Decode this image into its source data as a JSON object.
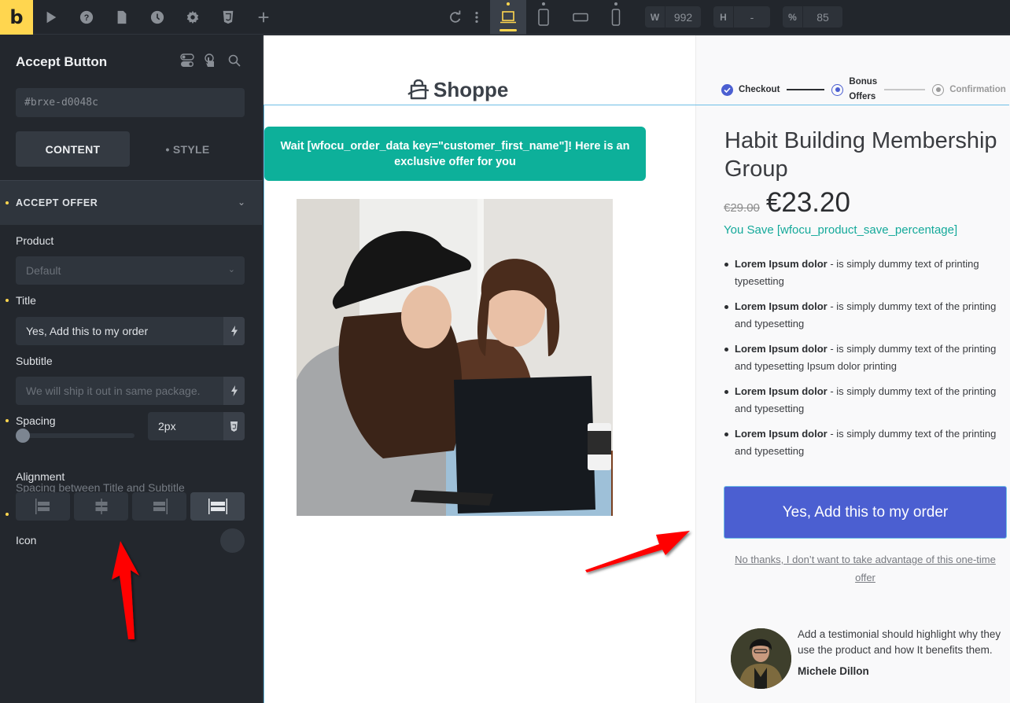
{
  "topbar": {
    "logo": "b",
    "tools": [
      "pointer-icon",
      "help-icon",
      "page-icon",
      "history-icon",
      "settings-icon",
      "css3-icon",
      "add-icon"
    ],
    "actions": [
      "redo-icon",
      "more-icon"
    ],
    "devices": [
      {
        "name": "laptop",
        "active": true
      },
      {
        "name": "tablet-portrait",
        "active": false
      },
      {
        "name": "tablet-landscape",
        "active": false
      },
      {
        "name": "mobile",
        "active": false
      }
    ],
    "width_label": "W",
    "width_value": "992",
    "height_label": "H",
    "height_value": "-",
    "zoom_label": "%",
    "zoom_value": "85"
  },
  "sidebar": {
    "title": "Accept Button",
    "element_id": "#brxe-d0048c",
    "tabs": {
      "content": "CONTENT",
      "style": "• STYLE"
    },
    "group": {
      "label": "ACCEPT OFFER"
    },
    "product": {
      "label": "Product",
      "value": "Default"
    },
    "title_field": {
      "label": "Title",
      "value": "Yes, Add this to my order"
    },
    "subtitle_field": {
      "label": "Subtitle",
      "placeholder": "We will ship it out in same package."
    },
    "spacing": {
      "label": "Spacing",
      "value": "2px",
      "help": "Spacing between Title and Subtitle",
      "slider_fraction": 0.0
    },
    "alignment": {
      "label": "Alignment",
      "options": [
        "left",
        "center",
        "right",
        "justify"
      ],
      "selected": "justify"
    },
    "icon": {
      "label": "Icon"
    }
  },
  "canvas": {
    "brand": "Shoppe",
    "steps": [
      {
        "label": "Checkout",
        "state": "done"
      },
      {
        "label": "Bonus\nOffers",
        "state": "current"
      },
      {
        "label": "Confirmation",
        "state": "upcoming"
      }
    ],
    "banner": "Wait [wfocu_order_data key=\"customer_first_name\"]! Here is an exclusive offer for you",
    "product_title": "Habit Building Membership Group",
    "old_price": "€29.00",
    "new_price": "€23.20",
    "save_text": "You Save [wfocu_product_save_percentage]",
    "bullets": [
      {
        "bold": "Lorem Ipsum dolor",
        "text": " - is simply dummy text of printing typesetting"
      },
      {
        "bold": "Lorem Ipsum dolor",
        "text": " - is simply dummy text of the printing and typesetting"
      },
      {
        "bold": "Lorem Ipsum dolor",
        "text": " - is simply dummy text of the printing and typesetting Ipsum dolor printing"
      },
      {
        "bold": "Lorem Ipsum dolor",
        "text": " - is simply dummy text of the printing and typesetting"
      },
      {
        "bold": "Lorem Ipsum dolor",
        "text": " - is simply dummy text of the printing and typesetting"
      }
    ],
    "cta_label": "Yes, Add this to my order",
    "decline_label": "No thanks, I don’t want to take advantage of this one-time offer",
    "testimonial": {
      "quote": "Add a testimonial should highlight why they use the product and how It benefits them.",
      "author": "Michele Dillon"
    }
  },
  "colors": {
    "accent_yellow": "#ffd64f",
    "banner_teal": "#0db09a",
    "cta_blue": "#4b5fd1",
    "step_blue": "#4b5fd1",
    "annotation_red": "#ff0000"
  }
}
